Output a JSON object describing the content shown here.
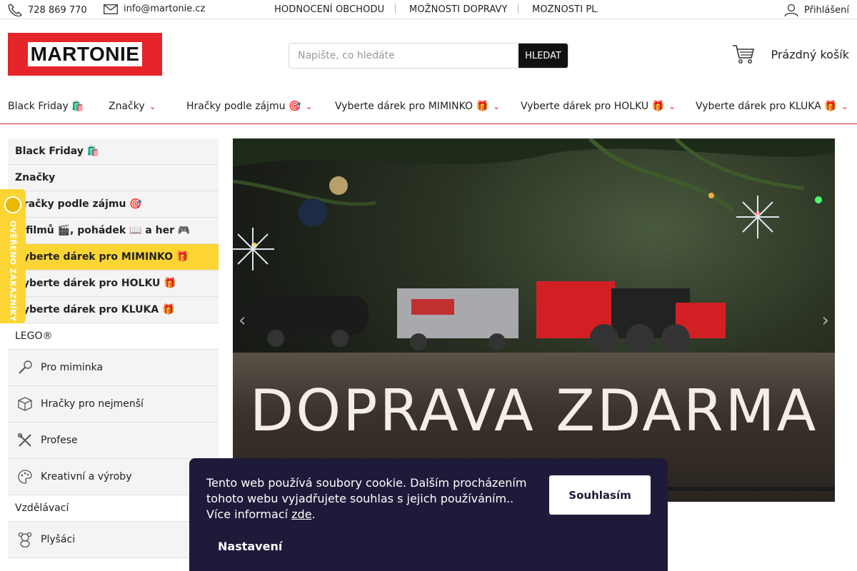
{
  "topbar": {
    "phone": "728 869 770",
    "email": "info@martonie.cz",
    "links": [
      "HODNOCENÍ OBCHODU",
      "MOŽNOSTI DOPRAVY",
      "MOŽNOSTI PLA"
    ],
    "login": "Přihlášení"
  },
  "header": {
    "logo": "MARTONIE",
    "search_placeholder": "Napište, co hledáte",
    "search_button": "HLEDAT",
    "cart": "Prázdný košík"
  },
  "nav": [
    {
      "label": "Black Friday 🛍️"
    },
    {
      "label": "Značky"
    },
    {
      "label": "Hračky podle zájmu 🎯"
    },
    {
      "label": "Vyberte dárek pro MIMINKO 🎁"
    },
    {
      "label": "Vyberte dárek pro HOLKU 🎁"
    },
    {
      "label": "Vyberte dárek pro KLUKA 🎁"
    }
  ],
  "sidebar": {
    "categories": [
      "Black Friday 🛍️",
      "Značky",
      "Hračky podle zájmu 🎯",
      "Z filmů 🎬, pohádek 📖 a her 🎮",
      "Vyberte dárek pro MIMINKO 🎁",
      "Vyberte dárek pro HOLKU 🎁",
      "Vyberte dárek pro KLUKA 🎁",
      "LEGO®"
    ],
    "sub1": [
      "Pro miminka",
      "Hračky pro nejmenší",
      "Profese",
      "Kreativní a výroby"
    ],
    "vzdelavaci": "Vzdělávací",
    "sub2": [
      "Plyšáci"
    ]
  },
  "badge": {
    "text": "OVĚŘENO ZÁKAZNÍKY"
  },
  "banner": {
    "headline": "DOPRAVA ZDARMA"
  },
  "cookie": {
    "text": "Tento web používá soubory cookie. Dalším procházením tohoto webu vyjadřujete souhlas s jejich používáním..",
    "more": "Více informací",
    "link": "zde",
    "agree": "Souhlasím",
    "settings": "Nastavení"
  },
  "colors": {
    "brand_red": "#e5252a",
    "active_yellow": "#fcd535",
    "cookie_bg": "#1e1b3a"
  }
}
